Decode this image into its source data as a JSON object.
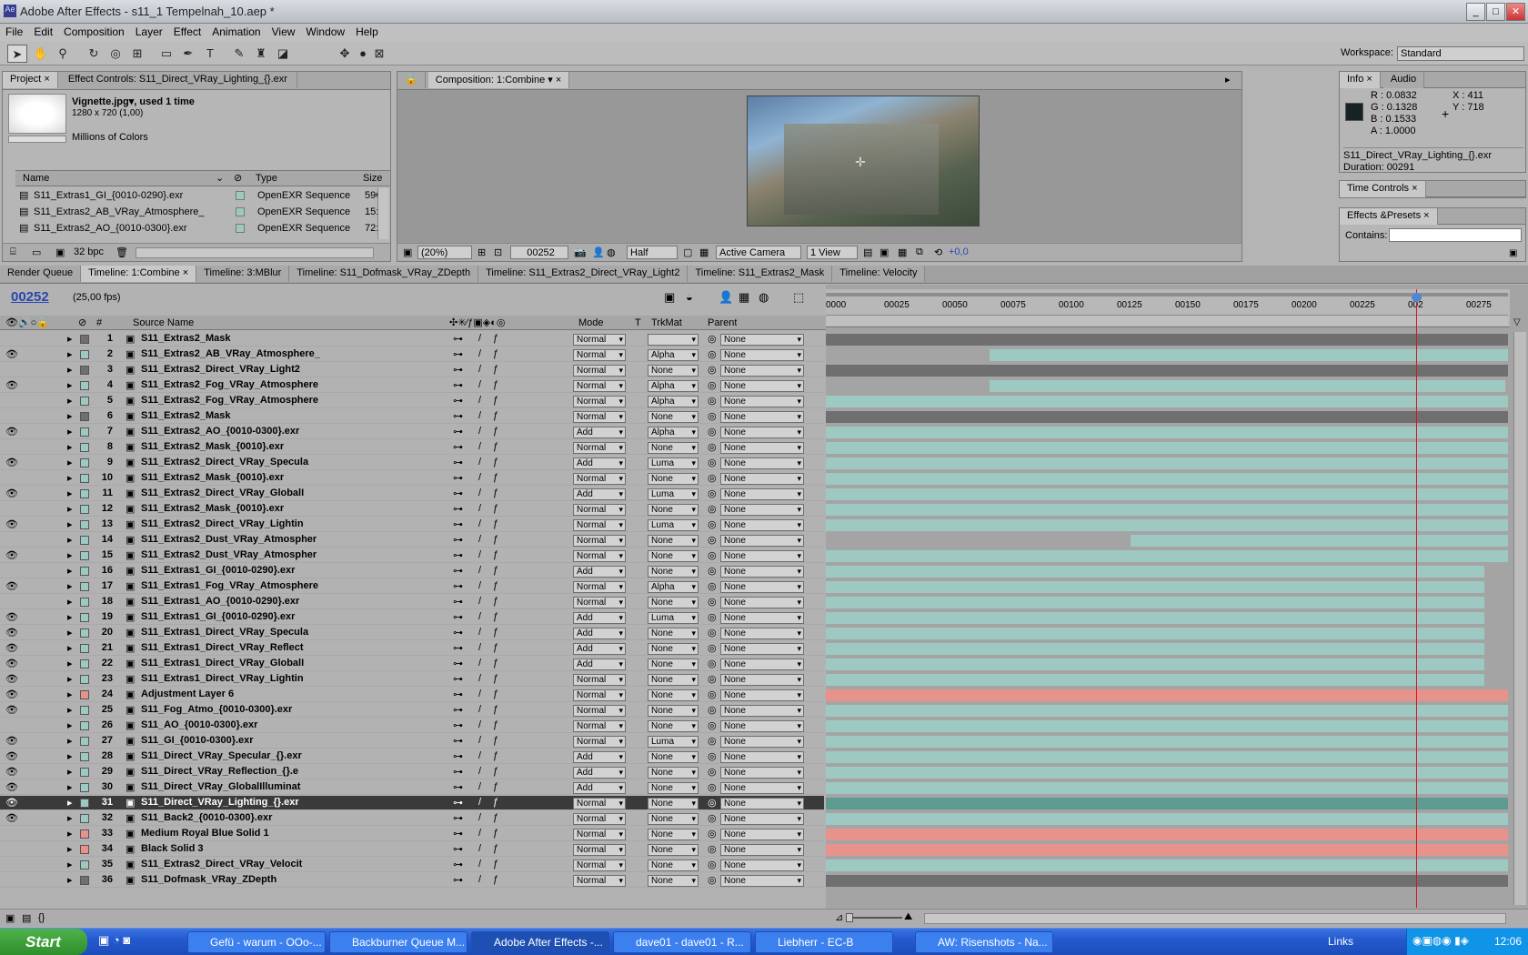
{
  "window": {
    "title": "Adobe After Effects - s11_1 Tempelnah_10.aep *",
    "min_label": "_",
    "max_label": "□",
    "close_label": "✕"
  },
  "menu": [
    "File",
    "Edit",
    "Composition",
    "Layer",
    "Effect",
    "Animation",
    "View",
    "Window",
    "Help"
  ],
  "workspace": {
    "label": "Workspace:",
    "value": "Standard"
  },
  "project": {
    "tab_label": "Project",
    "effect_controls_tab": "Effect Controls: S11_Direct_VRay_Lighting_{}.exr",
    "item_name": "Vignette.jpg▾, used 1 time",
    "item_dims": "1280 x 720 (1,00)",
    "item_colors": "Millions of Colors",
    "col_name": "Name",
    "col_type": "Type",
    "col_size": "Size",
    "rows": [
      {
        "name": "S11_Extras1_GI_{0010-0290}.exr",
        "type": "OpenEXR Sequence",
        "size": "59€"
      },
      {
        "name": "S11_Extras2_AB_VRay_Atmosphere_",
        "type": "OpenEXR Sequence",
        "size": "15:"
      },
      {
        "name": "S11_Extras2_AO_{0010-0300}.exr",
        "type": "OpenEXR Sequence",
        "size": "72:"
      }
    ],
    "bpc": "32 bpc"
  },
  "composition": {
    "tab_label": "Composition: 1:Combine",
    "zoom": "(20%)",
    "timecode": "00252",
    "resolution": "Half",
    "camera": "Active Camera",
    "views": "1 View",
    "exposure": "+0,0"
  },
  "info": {
    "tab_label": "Info",
    "audio_tab": "Audio",
    "r": "R : 0.0832",
    "g": "G : 0.1328",
    "b": "B : 0.1533",
    "a": "A : 1.0000",
    "x": "X : 411",
    "y": "Y : 718",
    "file": "S11_Direct_VRay_Lighting_{}.exr",
    "duration": "Duration: 00291"
  },
  "time_controls": {
    "tab_label": "Time Controls"
  },
  "effects_presets": {
    "tab_label": "Effects &Presets",
    "contains_label": "Contains:"
  },
  "timeline_tabs": [
    "Render Queue",
    "Timeline: 1:Combine",
    "Timeline: 3:MBlur",
    "Timeline: S11_Dofmask_VRay_ZDepth",
    "Timeline: S11_Extras2_Direct_VRay_Light2",
    "Timeline: S11_Extras2_Mask",
    "Timeline: Velocity"
  ],
  "timeline": {
    "current_time": "00252",
    "fps": "(25,00 fps)",
    "col_num": "#",
    "col_source": "Source Name",
    "col_mode": "Mode",
    "col_t": "T",
    "col_trkmat": "TrkMat",
    "col_parent": "Parent",
    "ruler": [
      "0000",
      "00025",
      "00050",
      "00075",
      "00100",
      "00125",
      "00150",
      "00175",
      "00200",
      "00225",
      "002",
      "00275"
    ],
    "playhead_frame": 252,
    "total_frames": 291,
    "layers": [
      {
        "num": "1",
        "name": "S11_Extras2_Mask",
        "mode": "Normal",
        "trk": "",
        "parent": "None",
        "color": "#6f6f6f",
        "bar": "#6f6f6f",
        "eye": false,
        "start": 0,
        "end": 291
      },
      {
        "num": "2",
        "name": "S11_Extras2_AB_VRay_Atmosphere_",
        "mode": "Normal",
        "trk": "Alpha",
        "parent": "None",
        "color": "#9ec9c2",
        "bar": "#9ec9c2",
        "eye": true,
        "start": 70,
        "end": 291
      },
      {
        "num": "3",
        "name": "S11_Extras2_Direct_VRay_Light2",
        "mode": "Normal",
        "trk": "None",
        "parent": "None",
        "color": "#6f6f6f",
        "bar": "#6f6f6f",
        "eye": false,
        "start": 0,
        "end": 291
      },
      {
        "num": "4",
        "name": "S11_Extras2_Fog_VRay_Atmosphere",
        "mode": "Normal",
        "trk": "Alpha",
        "parent": "None",
        "color": "#9ec9c2",
        "bar": "#9ec9c2",
        "eye": true,
        "start": 70,
        "end": 290
      },
      {
        "num": "5",
        "name": "S11_Extras2_Fog_VRay_Atmosphere",
        "mode": "Normal",
        "trk": "Alpha",
        "parent": "None",
        "color": "#9ec9c2",
        "bar": "#9ec9c2",
        "eye": false,
        "start": 0,
        "end": 291
      },
      {
        "num": "6",
        "name": "S11_Extras2_Mask",
        "mode": "Normal",
        "trk": "None",
        "parent": "None",
        "color": "#6f6f6f",
        "bar": "#6f6f6f",
        "eye": false,
        "start": 0,
        "end": 291
      },
      {
        "num": "7",
        "name": "S11_Extras2_AO_{0010-0300}.exr",
        "mode": "Add",
        "trk": "Alpha",
        "parent": "None",
        "color": "#9ec9c2",
        "bar": "#9ec9c2",
        "eye": true,
        "start": 0,
        "end": 291
      },
      {
        "num": "8",
        "name": "S11_Extras2_Mask_{0010}.exr",
        "mode": "Normal",
        "trk": "None",
        "parent": "None",
        "color": "#9ec9c2",
        "bar": "#9ec9c2",
        "eye": false,
        "start": 0,
        "end": 291
      },
      {
        "num": "9",
        "name": "S11_Extras2_Direct_VRay_Specula",
        "mode": "Add",
        "trk": "Luma",
        "parent": "None",
        "color": "#9ec9c2",
        "bar": "#9ec9c2",
        "eye": true,
        "start": 0,
        "end": 291
      },
      {
        "num": "10",
        "name": "S11_Extras2_Mask_{0010}.exr",
        "mode": "Normal",
        "trk": "None",
        "parent": "None",
        "color": "#9ec9c2",
        "bar": "#9ec9c2",
        "eye": false,
        "start": 0,
        "end": 291
      },
      {
        "num": "11",
        "name": "S11_Extras2_Direct_VRay_GlobalI",
        "mode": "Add",
        "trk": "Luma",
        "parent": "None",
        "color": "#9ec9c2",
        "bar": "#9ec9c2",
        "eye": true,
        "start": 0,
        "end": 291
      },
      {
        "num": "12",
        "name": "S11_Extras2_Mask_{0010}.exr",
        "mode": "Normal",
        "trk": "None",
        "parent": "None",
        "color": "#9ec9c2",
        "bar": "#9ec9c2",
        "eye": false,
        "start": 0,
        "end": 291
      },
      {
        "num": "13",
        "name": "S11_Extras2_Direct_VRay_Lightin",
        "mode": "Normal",
        "trk": "Luma",
        "parent": "None",
        "color": "#9ec9c2",
        "bar": "#9ec9c2",
        "eye": true,
        "start": 0,
        "end": 291
      },
      {
        "num": "14",
        "name": "S11_Extras2_Dust_VRay_Atmospher",
        "mode": "Normal",
        "trk": "None",
        "parent": "None",
        "color": "#9ec9c2",
        "bar": "#9ec9c2",
        "eye": false,
        "start": 130,
        "end": 291
      },
      {
        "num": "15",
        "name": "S11_Extras2_Dust_VRay_Atmospher",
        "mode": "Normal",
        "trk": "None",
        "parent": "None",
        "color": "#9ec9c2",
        "bar": "#9ec9c2",
        "eye": true,
        "start": 0,
        "end": 291
      },
      {
        "num": "16",
        "name": "S11_Extras1_GI_{0010-0290}.exr",
        "mode": "Add",
        "trk": "None",
        "parent": "None",
        "color": "#9ec9c2",
        "bar": "#9ec9c2",
        "eye": false,
        "start": 0,
        "end": 281
      },
      {
        "num": "17",
        "name": "S11_Extras1_Fog_VRay_Atmosphere",
        "mode": "Normal",
        "trk": "Alpha",
        "parent": "None",
        "color": "#9ec9c2",
        "bar": "#9ec9c2",
        "eye": true,
        "start": 0,
        "end": 281
      },
      {
        "num": "18",
        "name": "S11_Extras1_AO_{0010-0290}.exr",
        "mode": "Normal",
        "trk": "None",
        "parent": "None",
        "color": "#9ec9c2",
        "bar": "#9ec9c2",
        "eye": false,
        "start": 0,
        "end": 281
      },
      {
        "num": "19",
        "name": "S11_Extras1_GI_{0010-0290}.exr",
        "mode": "Add",
        "trk": "Luma",
        "parent": "None",
        "color": "#9ec9c2",
        "bar": "#9ec9c2",
        "eye": true,
        "start": 0,
        "end": 281
      },
      {
        "num": "20",
        "name": "S11_Extras1_Direct_VRay_Specula",
        "mode": "Add",
        "trk": "None",
        "parent": "None",
        "color": "#9ec9c2",
        "bar": "#9ec9c2",
        "eye": true,
        "start": 0,
        "end": 281
      },
      {
        "num": "21",
        "name": "S11_Extras1_Direct_VRay_Reflect",
        "mode": "Add",
        "trk": "None",
        "parent": "None",
        "color": "#9ec9c2",
        "bar": "#9ec9c2",
        "eye": true,
        "start": 0,
        "end": 281
      },
      {
        "num": "22",
        "name": "S11_Extras1_Direct_VRay_GlobalI",
        "mode": "Add",
        "trk": "None",
        "parent": "None",
        "color": "#9ec9c2",
        "bar": "#9ec9c2",
        "eye": true,
        "start": 0,
        "end": 281
      },
      {
        "num": "23",
        "name": "S11_Extras1_Direct_VRay_Lightin",
        "mode": "Normal",
        "trk": "None",
        "parent": "None",
        "color": "#9ec9c2",
        "bar": "#9ec9c2",
        "eye": true,
        "start": 0,
        "end": 281
      },
      {
        "num": "24",
        "name": "Adjustment Layer 6",
        "mode": "Normal",
        "trk": "None",
        "parent": "None",
        "color": "#e8928c",
        "bar": "#e8928c",
        "eye": true,
        "start": 0,
        "end": 291
      },
      {
        "num": "25",
        "name": "S11_Fog_Atmo_{0010-0300}.exr",
        "mode": "Normal",
        "trk": "None",
        "parent": "None",
        "color": "#9ec9c2",
        "bar": "#9ec9c2",
        "eye": true,
        "start": 0,
        "end": 291
      },
      {
        "num": "26",
        "name": "S11_AO_{0010-0300}.exr",
        "mode": "Normal",
        "trk": "None",
        "parent": "None",
        "color": "#9ec9c2",
        "bar": "#9ec9c2",
        "eye": false,
        "start": 0,
        "end": 291
      },
      {
        "num": "27",
        "name": "S11_GI_{0010-0300}.exr",
        "mode": "Normal",
        "trk": "Luma",
        "parent": "None",
        "color": "#9ec9c2",
        "bar": "#9ec9c2",
        "eye": true,
        "start": 0,
        "end": 291
      },
      {
        "num": "28",
        "name": "S11_Direct_VRay_Specular_{}.exr",
        "mode": "Add",
        "trk": "None",
        "parent": "None",
        "color": "#9ec9c2",
        "bar": "#9ec9c2",
        "eye": true,
        "start": 0,
        "end": 291
      },
      {
        "num": "29",
        "name": "S11_Direct_VRay_Reflection_{}.e",
        "mode": "Add",
        "trk": "None",
        "parent": "None",
        "color": "#9ec9c2",
        "bar": "#9ec9c2",
        "eye": true,
        "start": 0,
        "end": 291
      },
      {
        "num": "30",
        "name": "S11_Direct_VRay_GlobalIlluminat",
        "mode": "Add",
        "trk": "None",
        "parent": "None",
        "color": "#9ec9c2",
        "bar": "#9ec9c2",
        "eye": true,
        "start": 0,
        "end": 291
      },
      {
        "num": "31",
        "name": "S11_Direct_VRay_Lighting_{}.exr",
        "mode": "Normal",
        "trk": "None",
        "parent": "None",
        "color": "#9ec9c2",
        "bar": "#5d9a92",
        "eye": true,
        "start": 0,
        "end": 291,
        "selected": true
      },
      {
        "num": "32",
        "name": "S11_Back2_{0010-0300}.exr",
        "mode": "Normal",
        "trk": "None",
        "parent": "None",
        "color": "#9ec9c2",
        "bar": "#9ec9c2",
        "eye": true,
        "start": 0,
        "end": 291
      },
      {
        "num": "33",
        "name": "Medium Royal Blue Solid 1",
        "mode": "Normal",
        "trk": "None",
        "parent": "None",
        "color": "#e8928c",
        "bar": "#e8928c",
        "eye": false,
        "start": 0,
        "end": 291
      },
      {
        "num": "34",
        "name": "Black Solid 3",
        "mode": "Normal",
        "trk": "None",
        "parent": "None",
        "color": "#e8928c",
        "bar": "#e8928c",
        "eye": false,
        "start": 0,
        "end": 291
      },
      {
        "num": "35",
        "name": "S11_Extras2_Direct_VRay_Velocit",
        "mode": "Normal",
        "trk": "None",
        "parent": "None",
        "color": "#9ec9c2",
        "bar": "#9ec9c2",
        "eye": false,
        "start": 0,
        "end": 291
      },
      {
        "num": "36",
        "name": "S11_Dofmask_VRay_ZDepth",
        "mode": "Normal",
        "trk": "None",
        "parent": "None",
        "color": "#6f6f6f",
        "bar": "#6f6f6f",
        "eye": false,
        "start": 0,
        "end": 291
      }
    ]
  },
  "taskbar": {
    "start": "Start",
    "tasks": [
      "Gefü - warum - OOo-...",
      "Backburner Queue M...",
      "Adobe After Effects -...",
      "dave01 - dave01 - R...",
      "Liebherr - EC-B",
      "AW: Risenshots - Na..."
    ],
    "links": "Links",
    "clock": "12:06"
  }
}
